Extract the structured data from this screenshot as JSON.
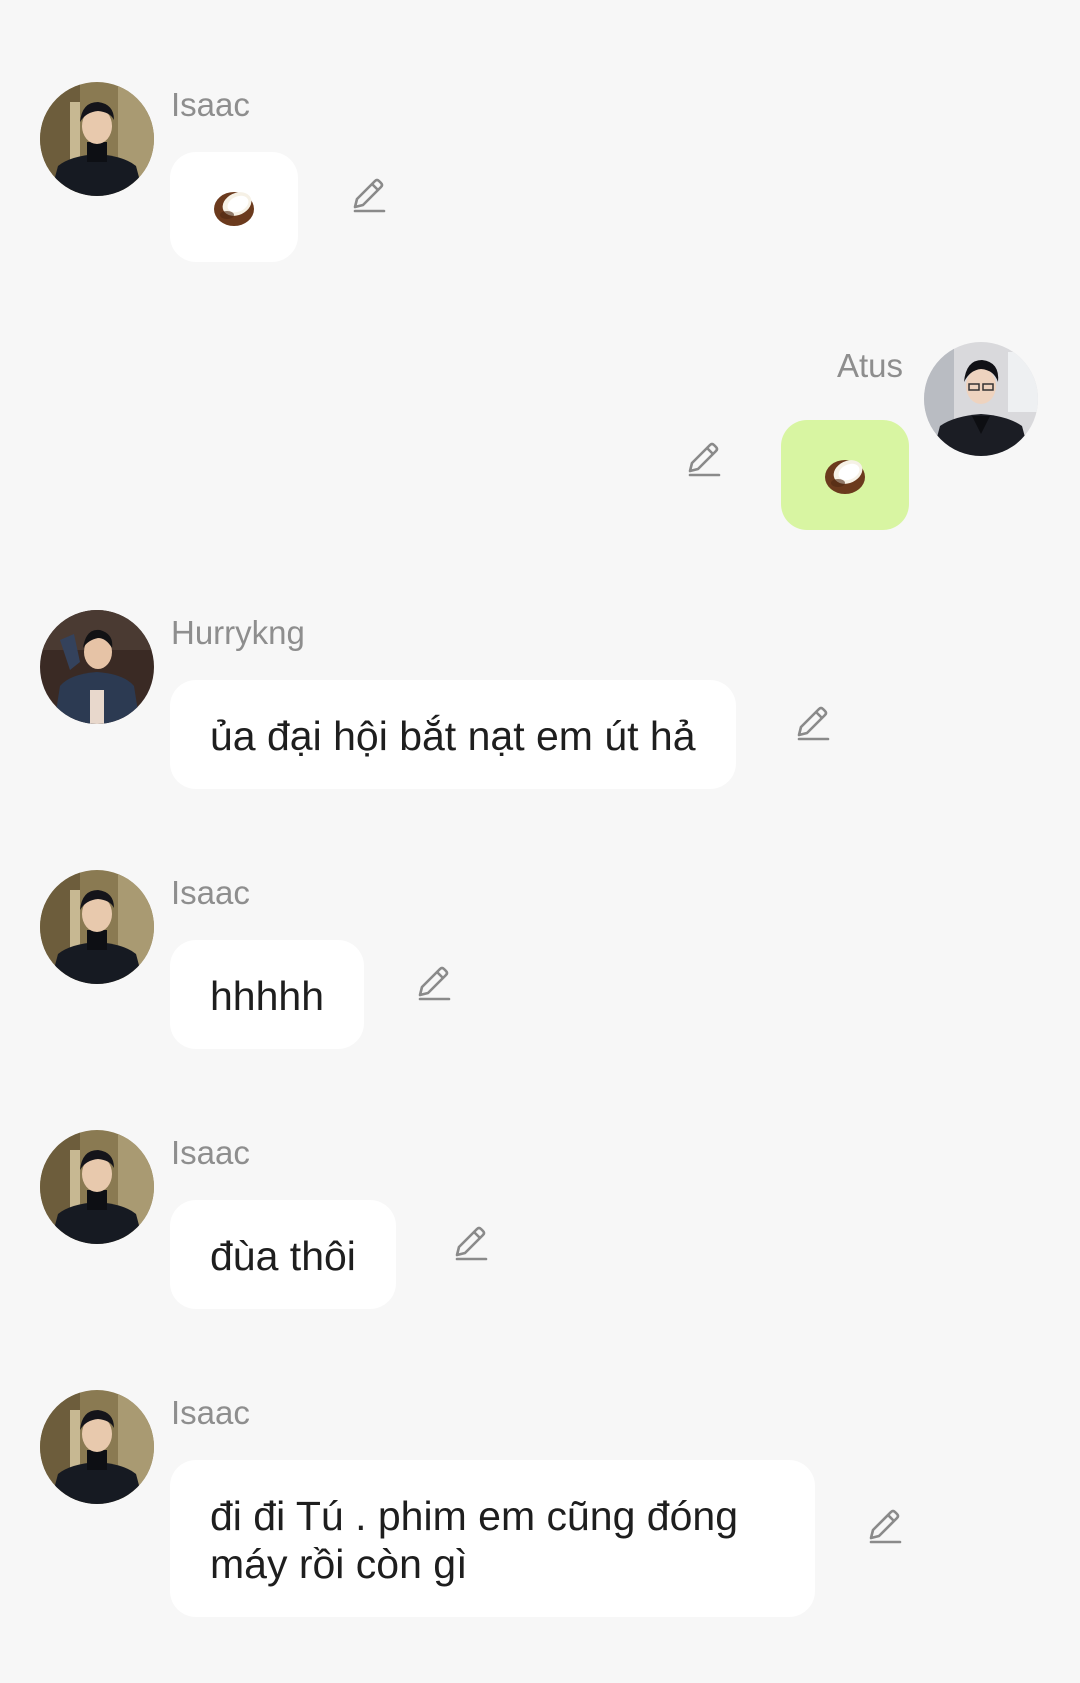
{
  "colors": {
    "background": "#f7f7f7",
    "bubble_incoming": "#ffffff",
    "bubble_outgoing": "#d8f5a2",
    "sender_name": "#8e8e8e",
    "text": "#1e1e1e",
    "edit_icon": "#8a8a8a"
  },
  "messages": [
    {
      "sender": "Isaac",
      "content": "coconut-emoji",
      "direction": "incoming"
    },
    {
      "sender": "Atus",
      "content": "coconut-emoji",
      "direction": "outgoing"
    },
    {
      "sender": "Hurrykng",
      "text": "ủa đại hội bắt nạt em út hả",
      "direction": "incoming"
    },
    {
      "sender": "Isaac",
      "text": "hhhhh",
      "direction": "incoming"
    },
    {
      "sender": "Isaac",
      "text": "đùa thôi",
      "direction": "incoming"
    },
    {
      "sender": "Isaac",
      "text": "đi đi Tú . phim em cũng đóng máy rồi còn gì",
      "direction": "incoming"
    }
  ],
  "icons": {
    "edit": "pencil-edit-icon",
    "emoji": "coconut-emoji-icon"
  }
}
